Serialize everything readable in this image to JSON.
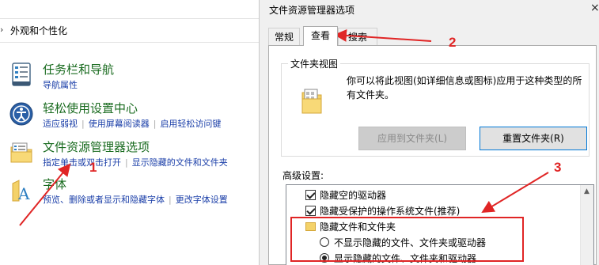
{
  "breadcrumb": {
    "chevron": "›",
    "label": "外观和个性化"
  },
  "items": [
    {
      "title": "任务栏和导航",
      "links": [
        "导航属性"
      ]
    },
    {
      "title": "轻松使用设置中心",
      "links": [
        "适应弱视",
        "使用屏幕阅读器",
        "启用轻松访问键"
      ]
    },
    {
      "title": "文件资源管理器选项",
      "links": [
        "指定单击或双击打开",
        "显示隐藏的文件和文件夹"
      ]
    },
    {
      "title": "字体",
      "links": [
        "预览、删除或者显示和隐藏字体",
        "更改字体设置"
      ]
    }
  ],
  "dialog": {
    "title": "文件资源管理器选项",
    "close": "×",
    "tabs": [
      "常规",
      "查看",
      "搜索"
    ],
    "folder_view": {
      "title": "文件夹视图",
      "description": "你可以将此视图(如详细信息或图标)应用于这种类型的所有文件夹。",
      "apply_button": "应用到文件夹(L)",
      "reset_button": "重置文件夹(R)"
    },
    "advanced_label": "高级设置:",
    "advanced_items": [
      {
        "type": "checkbox",
        "label": "隐藏空的驱动器",
        "checked": true
      },
      {
        "type": "checkbox",
        "label": "隐藏受保护的操作系统文件(推荐)",
        "checked": true
      },
      {
        "type": "folder",
        "label": "隐藏文件和文件夹"
      },
      {
        "type": "radio",
        "label": "不显示隐藏的文件、文件夹或驱动器",
        "checked": false
      },
      {
        "type": "radio",
        "label": "显示隐藏的文件、文件夹和驱动器",
        "checked": true
      }
    ]
  },
  "annotations": {
    "one": "1",
    "two": "2",
    "three": "3",
    "color": "#e02525"
  }
}
